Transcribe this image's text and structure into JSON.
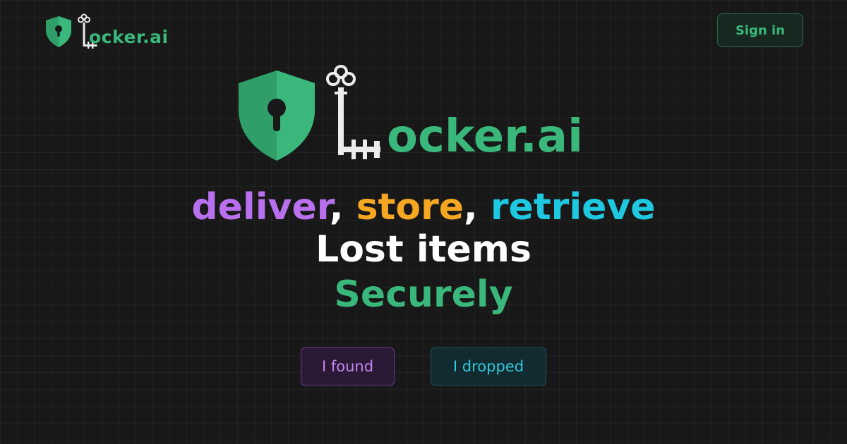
{
  "header": {
    "brand": "ocker.ai",
    "signin_label": "Sign in"
  },
  "hero": {
    "brand": "ocker.ai",
    "tagline": {
      "word1": "deliver",
      "sep1": ", ",
      "word2": "store",
      "sep2": ", ",
      "word3": "retrieve",
      "line2": "Lost items",
      "line3": "Securely"
    }
  },
  "actions": {
    "found_label": "I found",
    "dropped_label": "I dropped"
  },
  "colors": {
    "background": "#181818",
    "brand_green": "#3ab77a",
    "deliver": "#b870ee",
    "store": "#f5a623",
    "retrieve": "#1ec8e0"
  },
  "icons": {
    "logo_shield": "shield-keyhole-icon",
    "logo_key": "skeleton-key-icon"
  }
}
